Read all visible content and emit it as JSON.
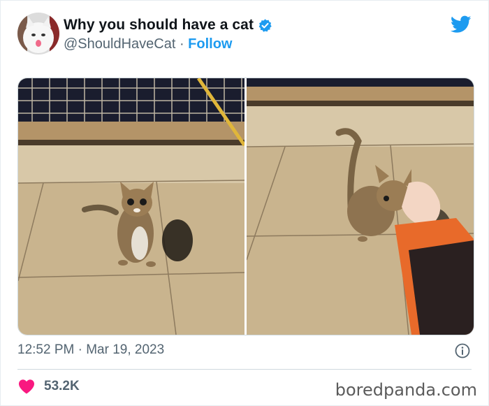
{
  "tweet": {
    "display_name": "Why you should have a cat",
    "handle": "@ShouldHaveCat",
    "separator": " · ",
    "follow_label": "Follow",
    "timestamp": "12:52 PM · Mar 19, 2023",
    "like_count": "53.2K"
  },
  "watermark": "boredpanda.com",
  "colors": {
    "accent": "#1d9bf0",
    "heart": "#f91880",
    "muted": "#536471"
  },
  "icons": [
    "verified-badge-icon",
    "twitter-bird-icon",
    "info-icon",
    "heart-icon"
  ]
}
